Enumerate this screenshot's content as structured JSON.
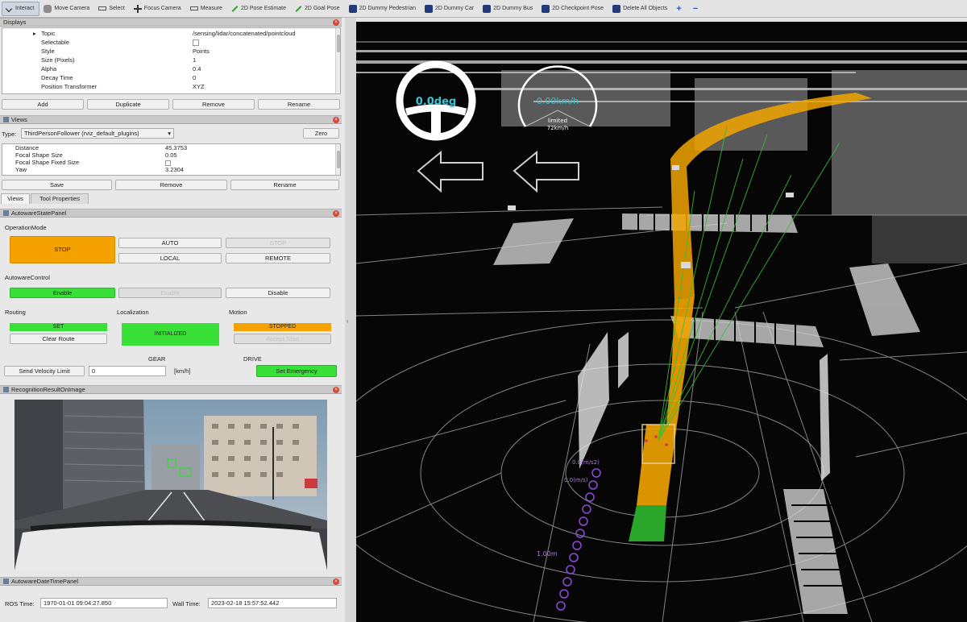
{
  "toolbar": {
    "items": [
      {
        "label": "Interact",
        "icon": "cursor-icon"
      },
      {
        "label": "Move Camera",
        "icon": "hand-icon"
      },
      {
        "label": "Select",
        "icon": "select-icon"
      },
      {
        "label": "Focus Camera",
        "icon": "crosshair-icon"
      },
      {
        "label": "Measure",
        "icon": "ruler-icon"
      },
      {
        "label": "2D Pose Estimate",
        "icon": "pose-arrow-icon"
      },
      {
        "label": "2D Goal Pose",
        "icon": "goal-arrow-icon"
      },
      {
        "label": "2D Dummy Pedestrian",
        "icon": "pedestrian-icon"
      },
      {
        "label": "2D Dummy Car",
        "icon": "car-icon"
      },
      {
        "label": "2D Dummy Bus",
        "icon": "bus-icon"
      },
      {
        "label": "2D Checkpoint Pose",
        "icon": "checkpoint-icon"
      },
      {
        "label": "Delete All Objects",
        "icon": "delete-icon"
      }
    ],
    "plus": "+",
    "minus": "−"
  },
  "displays": {
    "title": "Displays",
    "rows": [
      {
        "name": "Topic",
        "value": "/sensing/lidar/concatenated/pointcloud"
      },
      {
        "name": "Selectable",
        "value": ""
      },
      {
        "name": "Style",
        "value": "Points"
      },
      {
        "name": "Size (Pixels)",
        "value": "1"
      },
      {
        "name": "Alpha",
        "value": "0.4"
      },
      {
        "name": "Decay Time",
        "value": "0"
      },
      {
        "name": "Position Transformer",
        "value": "XYZ"
      }
    ],
    "buttons": [
      "Add",
      "Duplicate",
      "Remove",
      "Rename"
    ]
  },
  "views": {
    "title": "Views",
    "type_label": "Type:",
    "type_value": "ThirdPersonFollower (rviz_default_plugins)",
    "zero": "Zero",
    "rows": [
      {
        "name": "Distance",
        "value": "45.3753"
      },
      {
        "name": "Focal Shape Size",
        "value": "0.05"
      },
      {
        "name": "Focal Shape Fixed Size",
        "value": ""
      },
      {
        "name": "Yaw",
        "value": "3.2304"
      }
    ],
    "buttons": [
      "Save",
      "Remove",
      "Rename"
    ],
    "tabs": [
      "Views",
      "Tool Properties"
    ]
  },
  "autoware_state": {
    "title": "AutowareStatePanel",
    "operation_mode_label": "OperationMode",
    "stop": "STOP",
    "auto": "AUTO",
    "local": "LOCAL",
    "stop_disabled": "STOP",
    "remote": "REMOTE",
    "control_label": "AutowareControl",
    "enable_active": "Enable",
    "enable_disabled": "Enable",
    "disable": "Disable",
    "routing_label": "Routing",
    "localization_label": "Localization",
    "motion_label": "Motion",
    "routing_status": "SET",
    "clear_route": "Clear Route",
    "localization_status": "INITIALIZED",
    "motion_status": "STOPPED",
    "motion_button": "Accept Start",
    "gear_label": "GEAR",
    "gear_value": "DRIVE",
    "send_velocity": "Send Velocity Limit",
    "velocity_value": "0",
    "unit": "[km/h]",
    "set_emergency": "Set Emergency"
  },
  "recognition": {
    "title": "RecognitionResultOnImage"
  },
  "datetime": {
    "title": "AutowareDateTimePanel",
    "ros_label": "ROS Time:",
    "ros_value": "1970-01-01 09:04:27.850",
    "wall_label": "Wall Time:",
    "wall_value": "2023-02-18 15:57:52.442"
  },
  "hud": {
    "steering": "0.0deg",
    "speed": "0.00km/h",
    "limited": "limited",
    "limit_value": "72km/h",
    "velocity_label": "0.0(m/s)",
    "accel_label": "0.0(m/s2)",
    "distance_label": "1.00m"
  },
  "colors": {
    "orange": "#f5a100",
    "green": "#38e038",
    "cyan": "#34c6d8",
    "path_yellow": "#f2a400",
    "path_green": "#2aa62a",
    "purple": "#8f4bd8"
  }
}
